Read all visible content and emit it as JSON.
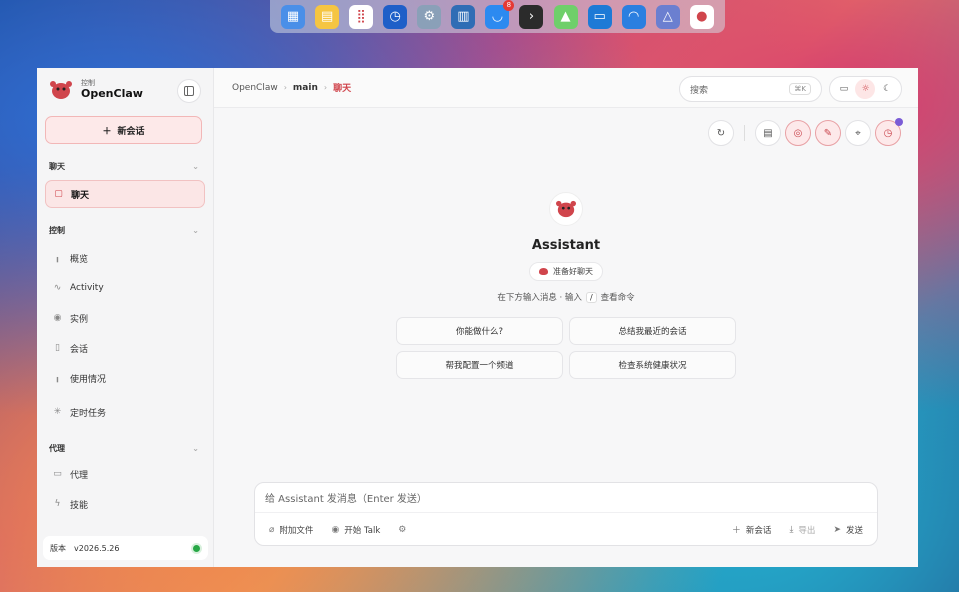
{
  "dock": {
    "items": [
      {
        "name": "window-manager-icon",
        "bg": "#4a8fe8",
        "glyph": "▦"
      },
      {
        "name": "notes-icon",
        "bg": "#f5c542",
        "glyph": "▤"
      },
      {
        "name": "launchpad-icon",
        "bg": "#ffffff",
        "glyph": "⣿"
      },
      {
        "name": "clock-icon",
        "bg": "#1e5fc8",
        "glyph": "◷"
      },
      {
        "name": "settings-icon",
        "bg": "#8aa0b8",
        "glyph": "⚙"
      },
      {
        "name": "database-icon",
        "bg": "#2f6db5",
        "glyph": "▥"
      },
      {
        "name": "app-store-icon",
        "bg": "#2c8af0",
        "glyph": "◡",
        "badge": "8"
      },
      {
        "name": "terminal-icon",
        "bg": "#2b2b2b",
        "glyph": "›"
      },
      {
        "name": "android-icon",
        "bg": "#6fcf6a",
        "glyph": "▲"
      },
      {
        "name": "docker-icon",
        "bg": "#1d7ad6",
        "glyph": "▭"
      },
      {
        "name": "headset-icon",
        "bg": "#2b7fe0",
        "glyph": "◠"
      },
      {
        "name": "prism-icon",
        "bg": "#6b7fd0",
        "glyph": "△"
      },
      {
        "name": "openclaw-icon",
        "bg": "#ffffff",
        "glyph": "●"
      }
    ]
  },
  "brand": {
    "subtitle": "控制",
    "name": "OpenClaw"
  },
  "sidebar": {
    "new_chat": "新会话",
    "sections": {
      "chat": "聊天",
      "control": "控制",
      "agent": "代理"
    },
    "chat_items": [
      {
        "label": "聊天",
        "icon": "chat-bubble-icon",
        "glyph": "▢"
      }
    ],
    "control_items": [
      {
        "label": "概览",
        "icon": "bar-chart-icon",
        "glyph": "╻"
      },
      {
        "label": "Activity",
        "icon": "activity-icon",
        "glyph": "∿"
      },
      {
        "label": "实例",
        "icon": "broadcast-icon",
        "glyph": "◉"
      },
      {
        "label": "会话",
        "icon": "document-icon",
        "glyph": "▯"
      },
      {
        "label": "使用情况",
        "icon": "usage-chart-icon",
        "glyph": "╻"
      },
      {
        "label": "定时任务",
        "icon": "loading-icon",
        "glyph": "✳"
      }
    ],
    "agent_items": [
      {
        "label": "代理",
        "icon": "folder-icon",
        "glyph": "▭"
      },
      {
        "label": "技能",
        "icon": "lightning-icon",
        "glyph": "ϟ"
      }
    ],
    "version_label": "版本",
    "version_value": "v2026.5.26"
  },
  "topbar": {
    "crumbs": [
      "OpenClaw",
      "main",
      "聊天"
    ],
    "search_placeholder": "搜索",
    "search_shortcut": "⌘K"
  },
  "hero": {
    "title": "Assistant",
    "status": "准备好聊天",
    "hint_before": "在下方输入消息 · 输入",
    "hint_key": "/",
    "hint_after": "查看命令"
  },
  "suggestions": [
    "你能做什么?",
    "总结我最近的会话",
    "帮我配置一个频道",
    "检查系统健康状况"
  ],
  "composer": {
    "placeholder": "给 Assistant 发消息（Enter 发送）",
    "attach": "附加文件",
    "talk": "开始 Talk",
    "new_session": "新会话",
    "export": "导出",
    "send": "发送"
  },
  "colors": {
    "accent": "#d0454c",
    "online": "#27a745"
  }
}
